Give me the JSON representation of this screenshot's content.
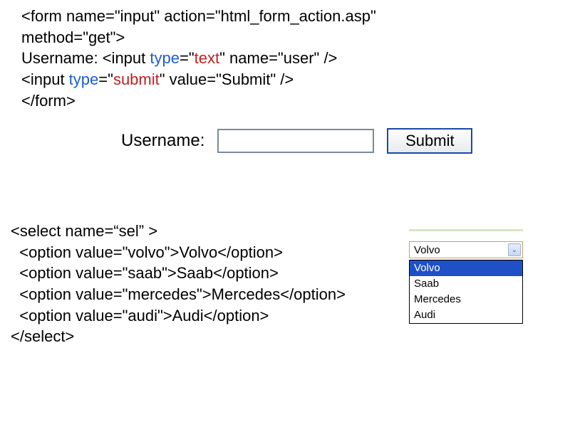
{
  "code1": {
    "line1_a": "<form name=\"input\" action=\"html_form_action.asp\"",
    "line2": "method=\"get\">",
    "line3_a": "Username: <input ",
    "line3_type": "type",
    "line3_eq": "=\"",
    "line3_text": "text",
    "line3_b": "\" name=\"user\" />",
    "line4_a": "<input ",
    "line4_type": "type",
    "line4_eq": "=\"",
    "line4_submit": "submit",
    "line4_b": "\" value=\"Submit\" />",
    "line5": "</form>"
  },
  "form": {
    "label": "Username:",
    "input_value": "",
    "submit_label": "Submit"
  },
  "code2": {
    "line1": "<select name=“sel” >",
    "line2": "  <option value=\"volvo\">Volvo</option>",
    "line3": "  <option value=\"saab\">Saab</option>",
    "line4": "  <option value=\"mercedes\">Mercedes</option>",
    "line5": "  <option value=\"audi\">Audi</option>",
    "line6": "</select>"
  },
  "select": {
    "selected": "Volvo",
    "options": {
      "0": "Volvo",
      "1": "Saab",
      "2": "Mercedes",
      "3": "Audi"
    }
  }
}
